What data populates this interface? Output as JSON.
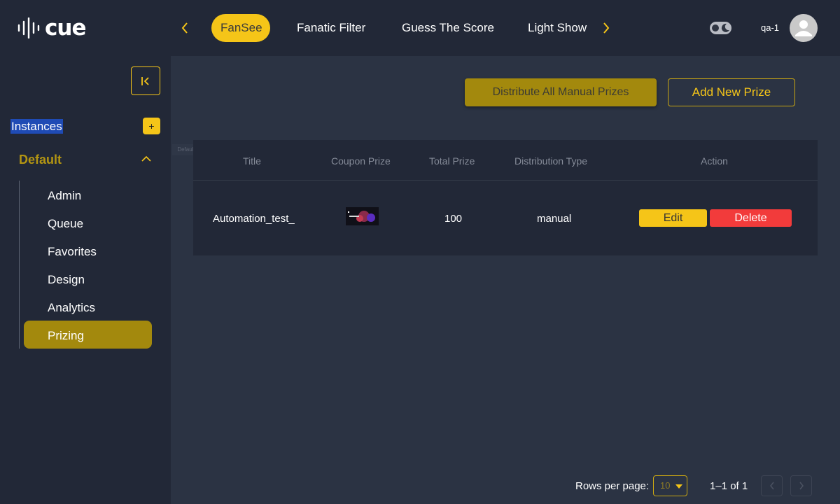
{
  "header": {
    "logo_text": "cue",
    "tabs": [
      {
        "label": "FanSee",
        "active": true
      },
      {
        "label": "Fanatic Filter",
        "active": false
      },
      {
        "label": "Guess The Score",
        "active": false
      },
      {
        "label": "Light Show",
        "active": false
      }
    ],
    "user_name": "qa-1",
    "icons": {
      "prev": "chevron-left-icon",
      "next": "chevron-right-icon",
      "theme_toggle": "moon-icon",
      "avatar": "user-icon"
    }
  },
  "sidebar": {
    "instances_label": "Instances",
    "add_instance_label": "+",
    "group_label": "Default",
    "menu_items": [
      {
        "label": "Admin",
        "active": false
      },
      {
        "label": "Queue",
        "active": false
      },
      {
        "label": "Favorites",
        "active": false
      },
      {
        "label": "Design",
        "active": false
      },
      {
        "label": "Analytics",
        "active": false
      },
      {
        "label": "Prizing",
        "active": true
      }
    ],
    "tooltip_ghost": "Default"
  },
  "main": {
    "distribute_label": "Distribute All Manual Prizes",
    "add_prize_label": "Add New Prize",
    "table": {
      "columns": [
        "Title",
        "Coupon Prize",
        "Total Prize",
        "Distribution Type",
        "Action"
      ],
      "rows": [
        {
          "title": "Automation_test_",
          "total_prize": "100",
          "distribution_type": "manual",
          "edit_label": "Edit",
          "delete_label": "Delete"
        }
      ]
    }
  },
  "pagination": {
    "rows_per_page_label": "Rows per page:",
    "rows_per_page_value": "10",
    "range_label": "1–1 of 1"
  },
  "colors": {
    "accent": "#f5c518",
    "accent_dark": "#a3890d",
    "danger": "#f23b3b",
    "sidebar_bg": "#222837",
    "content_bg": "#2b3343"
  }
}
